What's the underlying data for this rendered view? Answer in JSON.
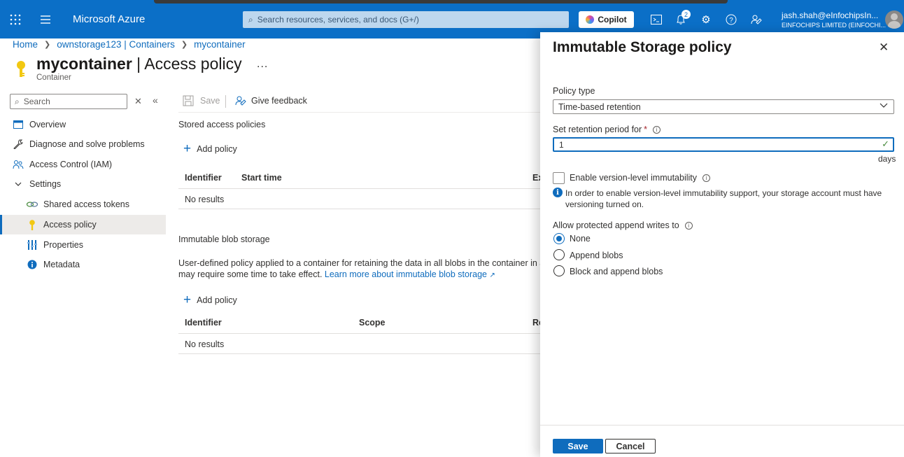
{
  "topbar": {
    "brand": "Microsoft Azure",
    "search_placeholder": "Search resources, services, and docs (G+/)",
    "copilot_label": "Copilot",
    "notification_count": "2",
    "user_name": "jash.shah@eInfochipsIn...",
    "user_org": "EINFOCHIPS LIMITED (EINFOCHI..."
  },
  "breadcrumb": [
    "Home",
    "ownstorage123 | Containers",
    "mycontainer"
  ],
  "header": {
    "title_bold": "mycontainer",
    "title_rest": " | Access policy",
    "subtitle": "Container",
    "more": "..."
  },
  "nav": {
    "search_placeholder": "Search",
    "items": [
      {
        "label": "Overview"
      },
      {
        "label": "Diagnose and solve problems"
      },
      {
        "label": "Access Control (IAM)"
      },
      {
        "label": "Settings"
      },
      {
        "label": "Shared access tokens"
      },
      {
        "label": "Access policy"
      },
      {
        "label": "Properties"
      },
      {
        "label": "Metadata"
      }
    ]
  },
  "toolbar": {
    "save_label": "Save",
    "feedback_label": "Give feedback"
  },
  "stored": {
    "heading": "Stored access policies",
    "add_label": "Add policy",
    "col_identifier": "Identifier",
    "col_start": "Start time",
    "col_expiry": "Ex",
    "empty": "No results"
  },
  "immutable": {
    "heading": "Immutable blob storage",
    "desc_line1": "User-defined policy applied to a container for retaining the data in all blobs in the container in a non",
    "desc_line2": "may require some time to take effect.",
    "link": "Learn more about immutable blob storage",
    "add_label": "Add policy",
    "col_identifier": "Identifier",
    "col_scope": "Scope",
    "col_re": "Re",
    "empty": "No results"
  },
  "panel": {
    "title": "Immutable Storage policy",
    "policy_type_label": "Policy type",
    "policy_type_value": "Time-based retention",
    "retention_label": "Set retention period for",
    "retention_value": "1",
    "retention_unit": "days",
    "version_label": "Enable version-level immutability",
    "version_checked": false,
    "info_text": "In order to enable version-level immutability support, your storage account must have versioning turned on.",
    "append_label": "Allow protected append writes to",
    "append_options": [
      "None",
      "Append blobs",
      "Block and append blobs"
    ],
    "append_selected": "None",
    "save_label": "Save",
    "cancel_label": "Cancel"
  },
  "colors": {
    "topbar": "#0b6fc7",
    "accent": "#0f6cbd",
    "key_icon": "#f2c811"
  }
}
